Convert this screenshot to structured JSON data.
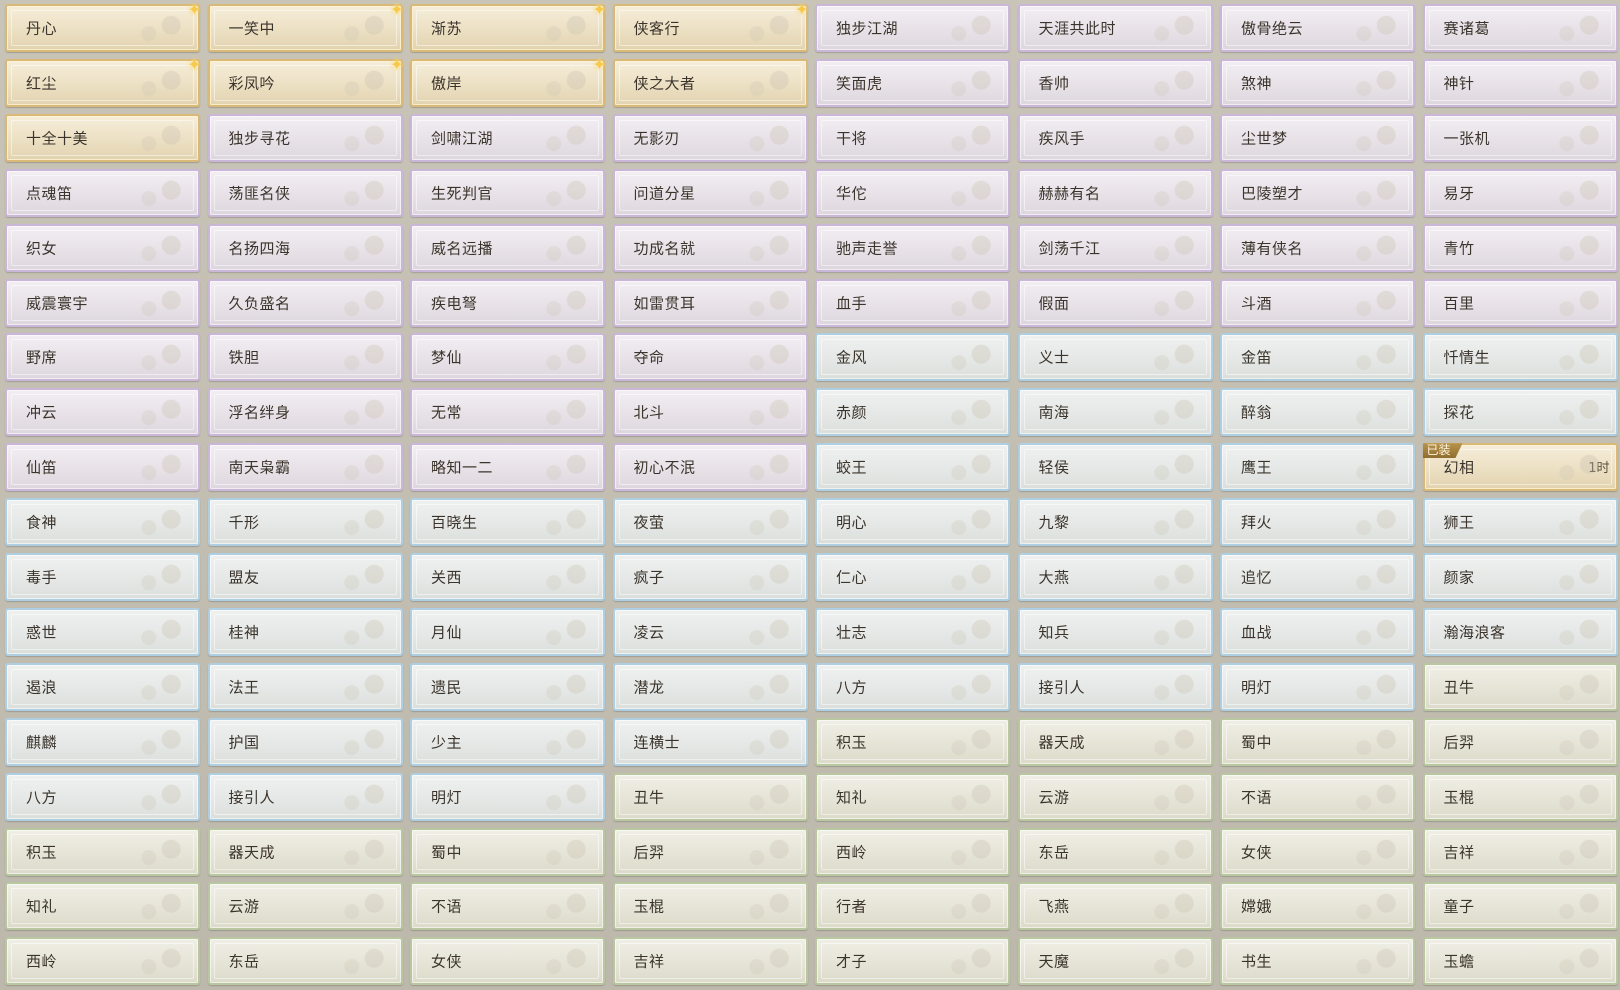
{
  "colors": {
    "gold": "#d9b978",
    "purple": "#c9b6d8",
    "blue": "#aecfe1",
    "green": "#b9c7a0",
    "sparkle": "#f6c94a",
    "badge": "#a07f3c"
  },
  "icons": {
    "sparkle": "✦"
  },
  "equipped_badge": "已装",
  "equipped_timer": "1时",
  "rows": [
    [
      {
        "label": "丹心",
        "tier": "gold",
        "sparkle": true
      },
      {
        "label": "一笑中",
        "tier": "gold",
        "sparkle": true
      },
      {
        "label": "渐苏",
        "tier": "gold",
        "sparkle": true
      },
      {
        "label": "侠客行",
        "tier": "gold",
        "sparkle": true
      },
      {
        "label": "独步江湖",
        "tier": "purple"
      },
      {
        "label": "天涯共此时",
        "tier": "purple"
      },
      {
        "label": "傲骨绝云",
        "tier": "purple"
      },
      {
        "label": "赛诸葛",
        "tier": "purple"
      }
    ],
    [
      {
        "label": "红尘",
        "tier": "gold",
        "sparkle": true
      },
      {
        "label": "彩凤吟",
        "tier": "gold",
        "sparkle": true
      },
      {
        "label": "傲岸",
        "tier": "gold",
        "sparkle": true
      },
      {
        "label": "侠之大者",
        "tier": "gold"
      },
      {
        "label": "笑面虎",
        "tier": "purple"
      },
      {
        "label": "香帅",
        "tier": "purple"
      },
      {
        "label": "煞神",
        "tier": "purple"
      },
      {
        "label": "神针",
        "tier": "purple"
      }
    ],
    [
      {
        "label": "十全十美",
        "tier": "gold"
      },
      {
        "label": "独步寻花",
        "tier": "purple"
      },
      {
        "label": "剑啸江湖",
        "tier": "purple"
      },
      {
        "label": "无影刃",
        "tier": "purple"
      },
      {
        "label": "干将",
        "tier": "purple"
      },
      {
        "label": "疾风手",
        "tier": "purple"
      },
      {
        "label": "尘世梦",
        "tier": "purple"
      },
      {
        "label": "一张机",
        "tier": "purple"
      }
    ],
    [
      {
        "label": "点魂笛",
        "tier": "purple"
      },
      {
        "label": "荡匪名侠",
        "tier": "purple"
      },
      {
        "label": "生死判官",
        "tier": "purple"
      },
      {
        "label": "问道分星",
        "tier": "purple"
      },
      {
        "label": "华佗",
        "tier": "purple"
      },
      {
        "label": "赫赫有名",
        "tier": "purple"
      },
      {
        "label": "巴陵塑才",
        "tier": "purple"
      },
      {
        "label": "易牙",
        "tier": "purple"
      }
    ],
    [
      {
        "label": "织女",
        "tier": "purple"
      },
      {
        "label": "名扬四海",
        "tier": "purple"
      },
      {
        "label": "威名远播",
        "tier": "purple"
      },
      {
        "label": "功成名就",
        "tier": "purple"
      },
      {
        "label": "驰声走誉",
        "tier": "purple"
      },
      {
        "label": "剑荡千江",
        "tier": "purple"
      },
      {
        "label": "薄有侠名",
        "tier": "purple"
      },
      {
        "label": "青竹",
        "tier": "purple"
      }
    ],
    [
      {
        "label": "威震寰宇",
        "tier": "purple"
      },
      {
        "label": "久负盛名",
        "tier": "purple"
      },
      {
        "label": "疾电弩",
        "tier": "purple"
      },
      {
        "label": "如雷贯耳",
        "tier": "purple"
      },
      {
        "label": "血手",
        "tier": "purple"
      },
      {
        "label": "假面",
        "tier": "purple"
      },
      {
        "label": "斗酒",
        "tier": "purple"
      },
      {
        "label": "百里",
        "tier": "purple"
      }
    ],
    [
      {
        "label": "野席",
        "tier": "purple"
      },
      {
        "label": "铁胆",
        "tier": "purple"
      },
      {
        "label": "梦仙",
        "tier": "purple"
      },
      {
        "label": "夺命",
        "tier": "purple"
      },
      {
        "label": "金风",
        "tier": "blue"
      },
      {
        "label": "义士",
        "tier": "blue"
      },
      {
        "label": "金笛",
        "tier": "blue"
      },
      {
        "label": "忏情生",
        "tier": "blue"
      }
    ],
    [
      {
        "label": "冲云",
        "tier": "purple"
      },
      {
        "label": "浮名绊身",
        "tier": "purple"
      },
      {
        "label": "无常",
        "tier": "purple"
      },
      {
        "label": "北斗",
        "tier": "purple"
      },
      {
        "label": "赤颜",
        "tier": "blue"
      },
      {
        "label": "南海",
        "tier": "blue"
      },
      {
        "label": "醉翁",
        "tier": "blue"
      },
      {
        "label": "探花",
        "tier": "blue"
      }
    ],
    [
      {
        "label": "仙笛",
        "tier": "purple"
      },
      {
        "label": "南天枭霸",
        "tier": "purple"
      },
      {
        "label": "略知一二",
        "tier": "purple"
      },
      {
        "label": "初心不泯",
        "tier": "purple"
      },
      {
        "label": "蛟王",
        "tier": "blue"
      },
      {
        "label": "轻侯",
        "tier": "blue"
      },
      {
        "label": "鹰王",
        "tier": "blue"
      },
      {
        "label": "幻相",
        "tier": "gold",
        "equipped": true
      }
    ],
    [
      {
        "label": "食神",
        "tier": "blue"
      },
      {
        "label": "千形",
        "tier": "blue"
      },
      {
        "label": "百晓生",
        "tier": "blue"
      },
      {
        "label": "夜萤",
        "tier": "blue"
      },
      {
        "label": "明心",
        "tier": "blue"
      },
      {
        "label": "九黎",
        "tier": "blue"
      },
      {
        "label": "拜火",
        "tier": "blue"
      },
      {
        "label": "狮王",
        "tier": "blue"
      }
    ],
    [
      {
        "label": "毒手",
        "tier": "blue"
      },
      {
        "label": "盟友",
        "tier": "blue"
      },
      {
        "label": "关西",
        "tier": "blue"
      },
      {
        "label": "疯子",
        "tier": "blue"
      },
      {
        "label": "仁心",
        "tier": "blue"
      },
      {
        "label": "大燕",
        "tier": "blue"
      },
      {
        "label": "追忆",
        "tier": "blue"
      },
      {
        "label": "颜家",
        "tier": "blue"
      }
    ],
    [
      {
        "label": "惑世",
        "tier": "blue"
      },
      {
        "label": "桂神",
        "tier": "blue"
      },
      {
        "label": "月仙",
        "tier": "blue"
      },
      {
        "label": "凌云",
        "tier": "blue"
      },
      {
        "label": "壮志",
        "tier": "blue"
      },
      {
        "label": "知兵",
        "tier": "blue"
      },
      {
        "label": "血战",
        "tier": "blue"
      },
      {
        "label": "瀚海浪客",
        "tier": "blue"
      }
    ],
    [
      {
        "label": "遏浪",
        "tier": "blue"
      },
      {
        "label": "法王",
        "tier": "blue"
      },
      {
        "label": "遗民",
        "tier": "blue"
      },
      {
        "label": "潜龙",
        "tier": "blue"
      },
      {
        "label": "八方",
        "tier": "blue"
      },
      {
        "label": "接引人",
        "tier": "blue"
      },
      {
        "label": "明灯",
        "tier": "blue"
      },
      {
        "label": "丑牛",
        "tier": "green"
      }
    ],
    [
      {
        "label": "麒麟",
        "tier": "blue"
      },
      {
        "label": "护国",
        "tier": "blue"
      },
      {
        "label": "少主",
        "tier": "blue"
      },
      {
        "label": "连横士",
        "tier": "blue"
      },
      {
        "label": "积玉",
        "tier": "green"
      },
      {
        "label": "器天成",
        "tier": "green"
      },
      {
        "label": "蜀中",
        "tier": "green"
      },
      {
        "label": "后羿",
        "tier": "green"
      }
    ],
    [
      {
        "label": "八方",
        "tier": "blue"
      },
      {
        "label": "接引人",
        "tier": "blue"
      },
      {
        "label": "明灯",
        "tier": "blue"
      },
      {
        "label": "丑牛",
        "tier": "green"
      },
      {
        "label": "知礼",
        "tier": "green"
      },
      {
        "label": "云游",
        "tier": "green"
      },
      {
        "label": "不语",
        "tier": "green"
      },
      {
        "label": "玉棍",
        "tier": "green"
      }
    ],
    [
      {
        "label": "积玉",
        "tier": "green"
      },
      {
        "label": "器天成",
        "tier": "green"
      },
      {
        "label": "蜀中",
        "tier": "green"
      },
      {
        "label": "后羿",
        "tier": "green"
      },
      {
        "label": "西岭",
        "tier": "green"
      },
      {
        "label": "东岳",
        "tier": "green"
      },
      {
        "label": "女侠",
        "tier": "green"
      },
      {
        "label": "吉祥",
        "tier": "green"
      }
    ],
    [
      {
        "label": "知礼",
        "tier": "green"
      },
      {
        "label": "云游",
        "tier": "green"
      },
      {
        "label": "不语",
        "tier": "green"
      },
      {
        "label": "玉棍",
        "tier": "green"
      },
      {
        "label": "行者",
        "tier": "green"
      },
      {
        "label": "飞燕",
        "tier": "green"
      },
      {
        "label": "嫦娥",
        "tier": "green"
      },
      {
        "label": "童子",
        "tier": "green"
      }
    ],
    [
      {
        "label": "西岭",
        "tier": "green"
      },
      {
        "label": "东岳",
        "tier": "green"
      },
      {
        "label": "女侠",
        "tier": "green"
      },
      {
        "label": "吉祥",
        "tier": "green"
      },
      {
        "label": "才子",
        "tier": "green"
      },
      {
        "label": "天魔",
        "tier": "green"
      },
      {
        "label": "书生",
        "tier": "green"
      },
      {
        "label": "玉蟾",
        "tier": "green"
      }
    ]
  ]
}
